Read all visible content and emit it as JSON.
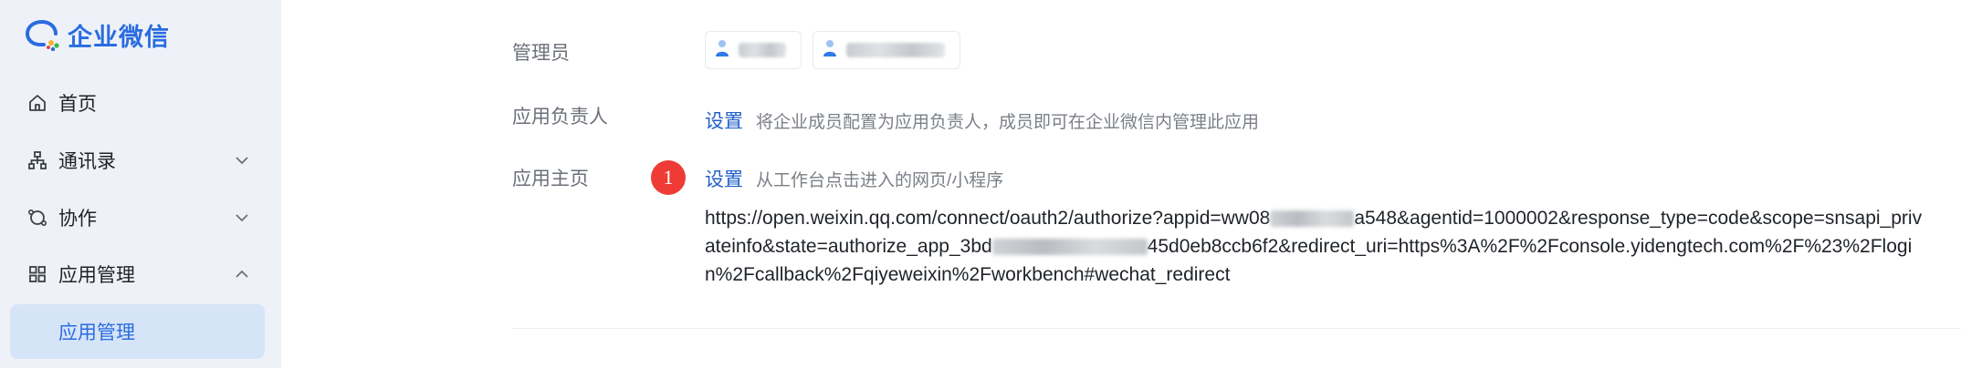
{
  "brand": {
    "name": "企业微信",
    "color": "#2a6ce0"
  },
  "sidebar": {
    "items": [
      {
        "label": "首页",
        "icon": "home-icon"
      },
      {
        "label": "通讯录",
        "icon": "org-chart-icon",
        "chevron": "chevron-down-icon"
      },
      {
        "label": "协作",
        "icon": "collab-icon",
        "chevron": "chevron-down-icon"
      },
      {
        "label": "应用管理",
        "icon": "grid-icon",
        "chevron": "chevron-up-icon"
      }
    ],
    "active_item": {
      "label": "应用管理"
    }
  },
  "main": {
    "admins": {
      "label": "管理员",
      "chips": [
        "(redacted name)",
        "(redacted name)"
      ]
    },
    "owner": {
      "label": "应用负责人",
      "action": "设置",
      "description": "将企业成员配置为应用负责人，成员即可在企业微信内管理此应用"
    },
    "homepage": {
      "label": "应用主页",
      "badge": "1",
      "action": "设置",
      "description": "从工作台点击进入的网页/小程序",
      "url_parts": [
        "https://open.weixin.qq.com/connect/oauth2/authorize?appid=ww08",
        "a548&agentid=1000002&response_type=code&scope=snsapi_privateinfo&state=authorize_app_3bd",
        "45d0eb8ccb6f2&redirect_uri=https%3A%2F%2Fconsole.yidengtech.com%2F%23%2Flogin%2Fcallback%2Fqiyeweixin%2Fworkbench#wechat_redirect"
      ]
    }
  },
  "colors": {
    "accent": "#2a6ce0",
    "badge": "#ee3b35",
    "link": "#2160c8"
  }
}
